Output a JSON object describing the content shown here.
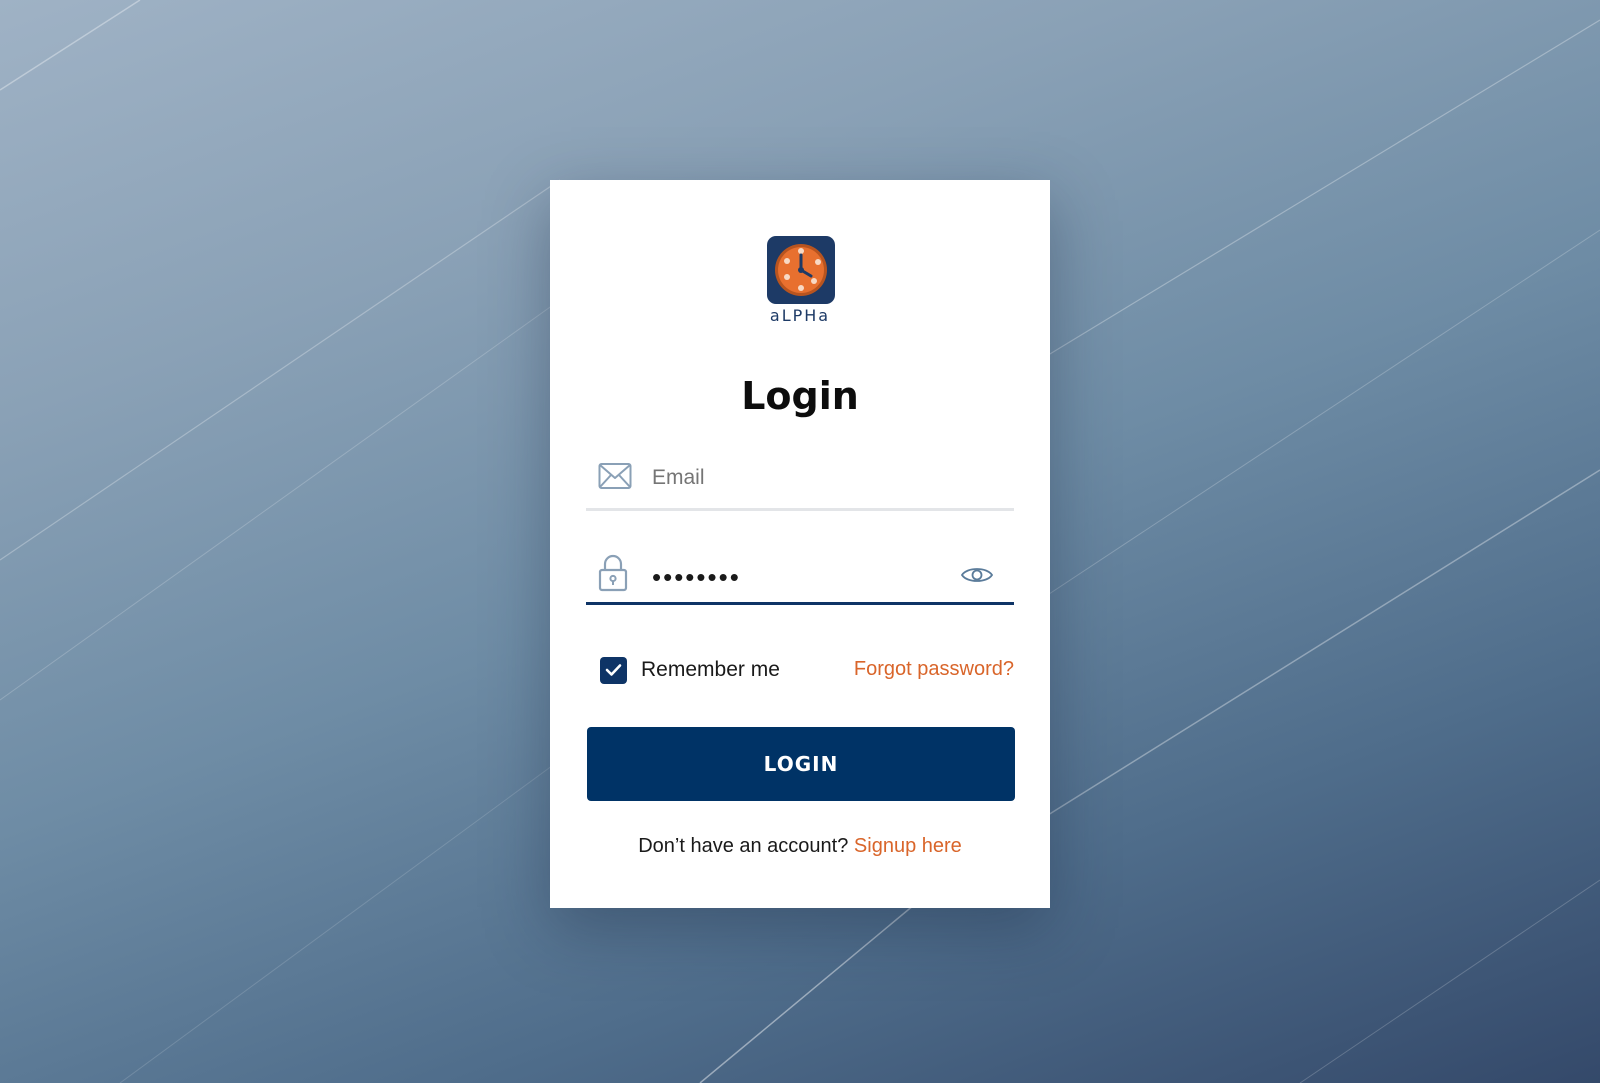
{
  "brand": {
    "name": "aLPHa",
    "logo_icon": "clock-icon",
    "colors": {
      "primary": "#003366",
      "accent": "#d9652a",
      "logo_orange": "#e8702f"
    }
  },
  "form": {
    "title": "Login",
    "email": {
      "icon": "envelope-icon",
      "placeholder": "Email",
      "value": ""
    },
    "password": {
      "icon": "lock-icon",
      "value": "••••••••",
      "toggle_icon": "eye-icon"
    },
    "remember_me": {
      "label": "Remember me",
      "checked": true
    },
    "forgot_password": "Forgot password?",
    "submit_label": "LOGIN",
    "signup_prompt": "Don’t have an account?",
    "signup_link": "Signup here"
  }
}
